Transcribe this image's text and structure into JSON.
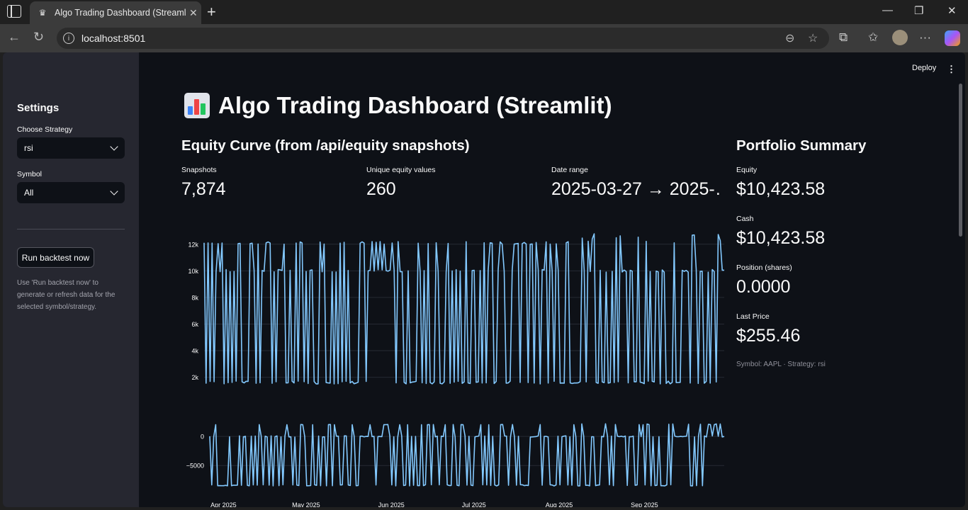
{
  "browser": {
    "tab_title": "Algo Trading Dashboard (Streamlit)",
    "url": "localhost:8501"
  },
  "header": {
    "deploy_label": "Deploy"
  },
  "sidebar": {
    "title": "Settings",
    "strategy_label": "Choose Strategy",
    "strategy_value": "rsi",
    "symbol_label": "Symbol",
    "symbol_value": "All",
    "run_button": "Run backtest now",
    "help_text": "Use 'Run backtest now' to generate or refresh data for the selected symbol/strategy."
  },
  "main": {
    "title": "Algo Trading Dashboard (Streamlit)",
    "equity_heading": "Equity Curve (from /api/equity snapshots)",
    "metrics": [
      {
        "label": "Snapshots",
        "value": "7,874"
      },
      {
        "label": "Unique equity values",
        "value": "260"
      },
      {
        "label": "Date range",
        "value": "2025-03-27 → 2025-…"
      }
    ],
    "portfolio": {
      "heading": "Portfolio Summary",
      "equity_label": "Equity",
      "equity_value": "$10,423.58",
      "cash_label": "Cash",
      "cash_value": "$10,423.58",
      "position_label": "Position (shares)",
      "position_value": "0.0000",
      "last_price_label": "Last Price",
      "last_price_value": "$255.46",
      "caption": "Symbol: AAPL · Strategy: rsi"
    }
  },
  "colors": {
    "accent_line": "#83c9ff",
    "background": "#0e1117",
    "sidebar": "#262730"
  },
  "chart_data": [
    {
      "type": "line",
      "title": "",
      "ytick_labels": [
        "2k",
        "4k",
        "6k",
        "8k",
        "10k",
        "12k"
      ],
      "ylim": [
        1500,
        13000
      ],
      "xtick_labels": [
        "Apr 2025",
        "May 2025",
        "Jun 2025",
        "Jul 2025",
        "Aug 2025",
        "Sep 2025"
      ],
      "x_range": [
        "2025-03-27",
        "2025-09-30"
      ],
      "baseline_value": 10000,
      "high_value": 12000,
      "low_value": 1500,
      "grid": true
    },
    {
      "type": "line",
      "title": "",
      "ytick_labels": [
        "0",
        "−5000"
      ],
      "ylim": [
        -8500,
        2200
      ],
      "xtick_labels": [
        "Apr 2025",
        "May 2025",
        "Jun 2025",
        "Jul 2025",
        "Aug 2025",
        "Sep 2025"
      ],
      "x_range": [
        "2025-03-27",
        "2025-09-30"
      ],
      "baseline_value": 0,
      "high_value": 2000,
      "low_value": -8500,
      "grid": true
    }
  ]
}
